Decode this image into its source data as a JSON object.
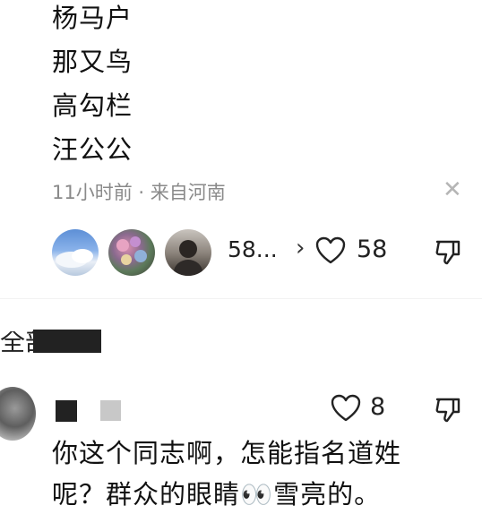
{
  "post": {
    "lines": [
      "杨马户",
      "那又鸟",
      "高勾栏",
      "汪公公"
    ],
    "meta": "11小时前 · 来自河南",
    "likers_count": "58...",
    "like_count": "58"
  },
  "section": {
    "title": "全部回复"
  },
  "comment": {
    "like_count": "8",
    "text_line1": "你这个同志啊，怎能指名道姓",
    "text_line2": "呢？群众的眼睛👀雪亮的。"
  },
  "icons": {
    "close": "close-icon",
    "heart": "heart-outline-icon",
    "dislike": "thumbs-down-icon",
    "chevron": "chevron-right-icon"
  }
}
